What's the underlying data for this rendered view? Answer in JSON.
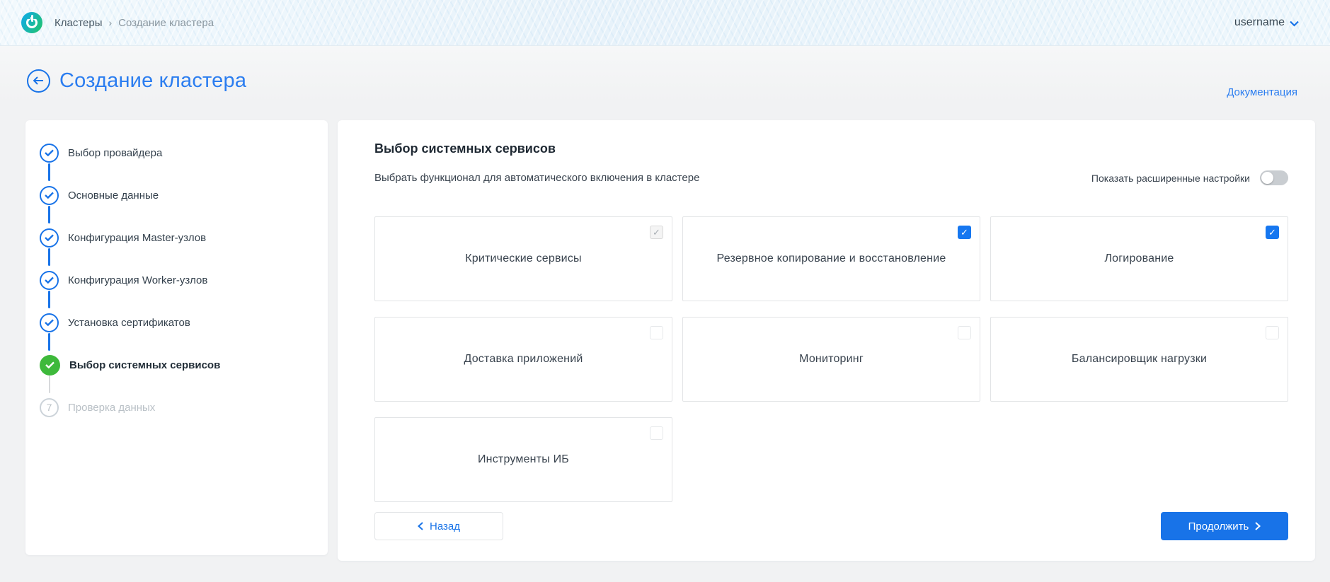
{
  "topbar": {
    "breadcrumb": {
      "root": "Кластеры",
      "separator": "›",
      "current": "Создание кластера"
    },
    "user": {
      "name": "username"
    }
  },
  "header": {
    "title": "Создание кластера",
    "docs_link": "Документация"
  },
  "stepper": {
    "steps": [
      {
        "label": "Выбор провайдера",
        "state": "done"
      },
      {
        "label": "Основные данные",
        "state": "done"
      },
      {
        "label": "Конфигурация Master-узлов",
        "state": "done"
      },
      {
        "label": "Конфигурация Worker-узлов",
        "state": "done"
      },
      {
        "label": "Установка сертификатов",
        "state": "done"
      },
      {
        "label": "Выбор системных сервисов",
        "state": "current"
      },
      {
        "label": "Проверка данных",
        "state": "pending",
        "number": "7"
      }
    ]
  },
  "panel": {
    "title": "Выбор системных сервисов",
    "subtitle": "Выбрать функционал для автоматического включения в кластере",
    "advanced_toggle": {
      "label": "Показать расширенные настройки",
      "state": "off"
    },
    "services": [
      {
        "label": "Критические сервисы",
        "checked": true,
        "disabled": true
      },
      {
        "label": "Резервное копирование и восстановление",
        "checked": true,
        "disabled": false
      },
      {
        "label": "Логирование",
        "checked": true,
        "disabled": false
      },
      {
        "label": "Доставка приложений",
        "checked": false,
        "disabled": false
      },
      {
        "label": "Мониторинг",
        "checked": false,
        "disabled": false
      },
      {
        "label": "Балансировщик нагрузки",
        "checked": false,
        "disabled": false
      },
      {
        "label": "Инструменты ИБ",
        "checked": false,
        "disabled": false
      }
    ],
    "back_label": "Назад",
    "continue_label": "Продолжить"
  },
  "colors": {
    "accent_blue": "#1873e8",
    "link_blue": "#2b7df0",
    "checkbox_blue": "#1677f0",
    "current_step_green": "#3eb93b"
  }
}
